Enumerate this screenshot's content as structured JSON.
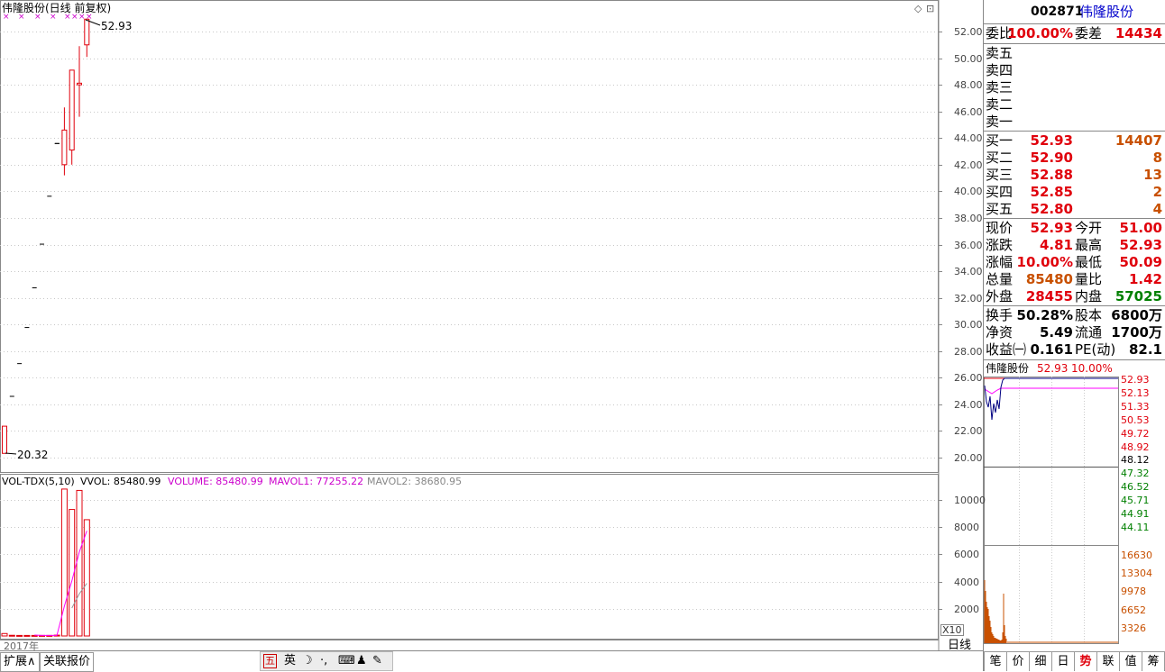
{
  "stock": {
    "code": "002871",
    "name": "伟隆股份",
    "chart_title": "伟隆股份(日线 前复权)",
    "high_label": "52.93",
    "low_label": "20.32",
    "year_label": "2017年",
    "period_label": "日线",
    "x10_label": "X10"
  },
  "vol_legend": {
    "name": "VOL-TDX(5,10)",
    "vvol": "VVOL: 85480.99",
    "volume": "VOLUME: 85480.99",
    "mavol1": "MAVOL1: 77255.22",
    "mavol2": "MAVOL2: 38680.95"
  },
  "price_axis": [
    "52.00",
    "50.00",
    "48.00",
    "46.00",
    "44.00",
    "42.00",
    "40.00",
    "38.00",
    "36.00",
    "34.00",
    "32.00",
    "30.00",
    "28.00",
    "26.00",
    "24.00",
    "22.00",
    "20.00"
  ],
  "vol_axis": [
    "10000",
    "8000",
    "6000",
    "4000",
    "2000"
  ],
  "quote": {
    "weibi_label": "委比",
    "weibi": "100.00%",
    "weicha_label": "委差",
    "weicha": "14434",
    "sells": [
      {
        "label": "卖五",
        "price": "",
        "vol": ""
      },
      {
        "label": "卖四",
        "price": "",
        "vol": ""
      },
      {
        "label": "卖三",
        "price": "",
        "vol": ""
      },
      {
        "label": "卖二",
        "price": "",
        "vol": ""
      },
      {
        "label": "卖一",
        "price": "",
        "vol": ""
      }
    ],
    "buys": [
      {
        "label": "买一",
        "price": "52.93",
        "vol": "14407"
      },
      {
        "label": "买二",
        "price": "52.90",
        "vol": "8"
      },
      {
        "label": "买三",
        "price": "52.88",
        "vol": "13"
      },
      {
        "label": "买四",
        "price": "52.85",
        "vol": "2"
      },
      {
        "label": "买五",
        "price": "52.80",
        "vol": "4"
      }
    ],
    "stats": [
      {
        "l1": "现价",
        "v1": "52.93",
        "c1": "red",
        "l2": "今开",
        "v2": "51.00",
        "c2": "red"
      },
      {
        "l1": "涨跌",
        "v1": "4.81",
        "c1": "red",
        "l2": "最高",
        "v2": "52.93",
        "c2": "red"
      },
      {
        "l1": "涨幅",
        "v1": "10.00%",
        "c1": "red",
        "l2": "最低",
        "v2": "50.09",
        "c2": "red"
      },
      {
        "l1": "总量",
        "v1": "85480",
        "c1": "orange",
        "l2": "量比",
        "v2": "1.42",
        "c2": "red"
      },
      {
        "l1": "外盘",
        "v1": "28455",
        "c1": "red",
        "l2": "内盘",
        "v2": "57025",
        "c2": "green"
      }
    ],
    "stats2": [
      {
        "l1": "换手",
        "v1": "50.28%",
        "l2": "股本",
        "v2": "6800万"
      },
      {
        "l1": "净资",
        "v1": "5.49",
        "l2": "流通",
        "v2": "1700万"
      },
      {
        "l1": "收益㈠",
        "v1": "0.161",
        "l2": "PE(动)",
        "v2": "82.1"
      }
    ]
  },
  "mini": {
    "title": "伟隆股份",
    "price": "52.93",
    "pct": "10.00%",
    "price_axis": [
      {
        "v": "52.93",
        "c": "red"
      },
      {
        "v": "52.13",
        "c": "red"
      },
      {
        "v": "51.33",
        "c": "red"
      },
      {
        "v": "50.53",
        "c": "red"
      },
      {
        "v": "49.72",
        "c": "red"
      },
      {
        "v": "48.92",
        "c": "red"
      },
      {
        "v": "48.12",
        "c": "black"
      },
      {
        "v": "47.32",
        "c": "green"
      },
      {
        "v": "46.52",
        "c": "green"
      },
      {
        "v": "45.71",
        "c": "green"
      },
      {
        "v": "44.91",
        "c": "green"
      },
      {
        "v": "44.11",
        "c": "green"
      }
    ],
    "vol_axis": [
      "16630",
      "13304",
      "9978",
      "6652",
      "3326"
    ]
  },
  "tabs": [
    "笔",
    "价",
    "细",
    "日",
    "势",
    "联",
    "值",
    "筹"
  ],
  "active_tab": "势",
  "bottom_tabs": [
    "扩展∧",
    "关联报价"
  ],
  "ime": {
    "wu": "五",
    "ying": "英"
  },
  "colors": {
    "up": "#e0000c",
    "down": "#008000",
    "vol_line": "#ff00ff",
    "intraday_price": "#000080",
    "intraday_avg": "#ff00ff"
  },
  "chart_data": [
    {
      "type": "candlestick",
      "title": "伟隆股份(日线 前复权)",
      "ylim": [
        19.5,
        53.5
      ],
      "candles": [
        {
          "o": 20.32,
          "h": 22.36,
          "l": 20.32,
          "c": 22.36
        },
        {
          "o": 24.6,
          "h": 24.6,
          "l": 24.6,
          "c": 24.6
        },
        {
          "o": 27.06,
          "h": 27.06,
          "l": 27.06,
          "c": 27.06
        },
        {
          "o": 29.77,
          "h": 29.77,
          "l": 29.77,
          "c": 29.77
        },
        {
          "o": 32.75,
          "h": 32.75,
          "l": 32.75,
          "c": 32.75
        },
        {
          "o": 36.03,
          "h": 36.03,
          "l": 36.03,
          "c": 36.03
        },
        {
          "o": 39.63,
          "h": 39.63,
          "l": 39.63,
          "c": 39.63
        },
        {
          "o": 43.59,
          "h": 43.59,
          "l": 43.59,
          "c": 43.59
        },
        {
          "o": 42.0,
          "h": 46.3,
          "l": 41.2,
          "c": 44.6
        },
        {
          "o": 43.1,
          "h": 49.1,
          "l": 42.0,
          "c": 49.1
        },
        {
          "o": 48.0,
          "h": 50.9,
          "l": 45.6,
          "c": 48.12
        },
        {
          "o": 51.0,
          "h": 52.93,
          "l": 50.09,
          "c": 52.93
        }
      ]
    },
    {
      "type": "bar",
      "title": "VOL-TDX(5,10)",
      "ylim": [
        0,
        11500
      ],
      "values": [
        180,
        50,
        40,
        40,
        40,
        40,
        40,
        60,
        10800,
        9300,
        10700,
        8548
      ],
      "series": [
        {
          "name": "MAVOL1",
          "values": [
            null,
            null,
            null,
            null,
            70,
            42,
            40,
            44,
            2196,
            4048,
            6180,
            7726
          ]
        },
        {
          "name": "MAVOL2",
          "values": [
            null,
            null,
            null,
            null,
            null,
            null,
            null,
            null,
            null,
            2052,
            3106,
            3868
          ]
        }
      ]
    }
  ]
}
